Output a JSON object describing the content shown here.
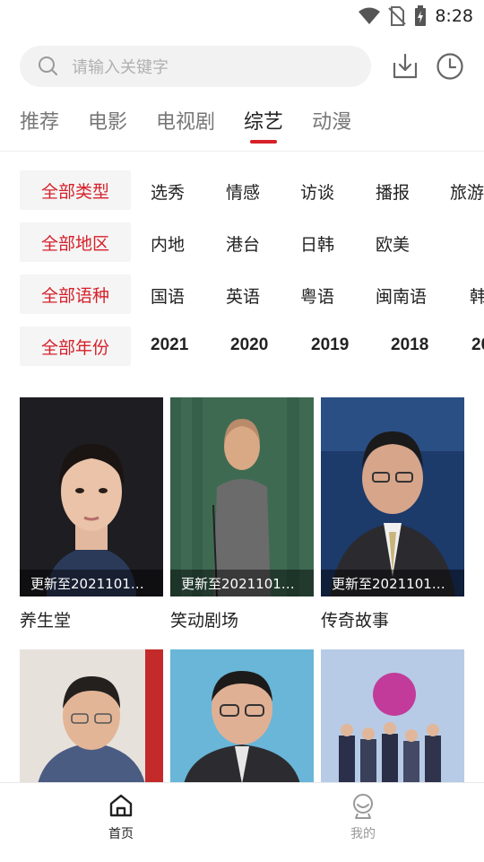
{
  "status_bar": {
    "time": "8:28"
  },
  "search": {
    "placeholder": "请输入关键字"
  },
  "tabs": [
    {
      "label": "推荐"
    },
    {
      "label": "电影"
    },
    {
      "label": "电视剧"
    },
    {
      "label": "综艺",
      "active": true
    },
    {
      "label": "动漫"
    }
  ],
  "filters": {
    "type": {
      "selected": "全部类型",
      "options": [
        "选秀",
        "情感",
        "访谈",
        "播报",
        "旅游"
      ]
    },
    "region": {
      "selected": "全部地区",
      "options": [
        "内地",
        "港台",
        "日韩",
        "欧美"
      ]
    },
    "language": {
      "selected": "全部语种",
      "options": [
        "国语",
        "英语",
        "粤语",
        "闽南语",
        "韩"
      ]
    },
    "year": {
      "selected": "全部年份",
      "options": [
        "2021",
        "2020",
        "2019",
        "2018",
        "20"
      ]
    }
  },
  "cards": [
    {
      "title": "养生堂",
      "badge": "更新至2021101…"
    },
    {
      "title": "笑动剧场",
      "badge": "更新至2021101…"
    },
    {
      "title": "传奇故事",
      "badge": "更新至2021101…"
    },
    {
      "title": "",
      "badge": ""
    },
    {
      "title": "",
      "badge": ""
    },
    {
      "title": "",
      "badge": ""
    }
  ],
  "bottom_nav": [
    {
      "label": "首页",
      "icon": "home-icon",
      "active": true
    },
    {
      "label": "我的",
      "icon": "profile-icon",
      "active": false
    }
  ],
  "colors": {
    "accent": "#d6202a",
    "inactive": "#999999"
  }
}
